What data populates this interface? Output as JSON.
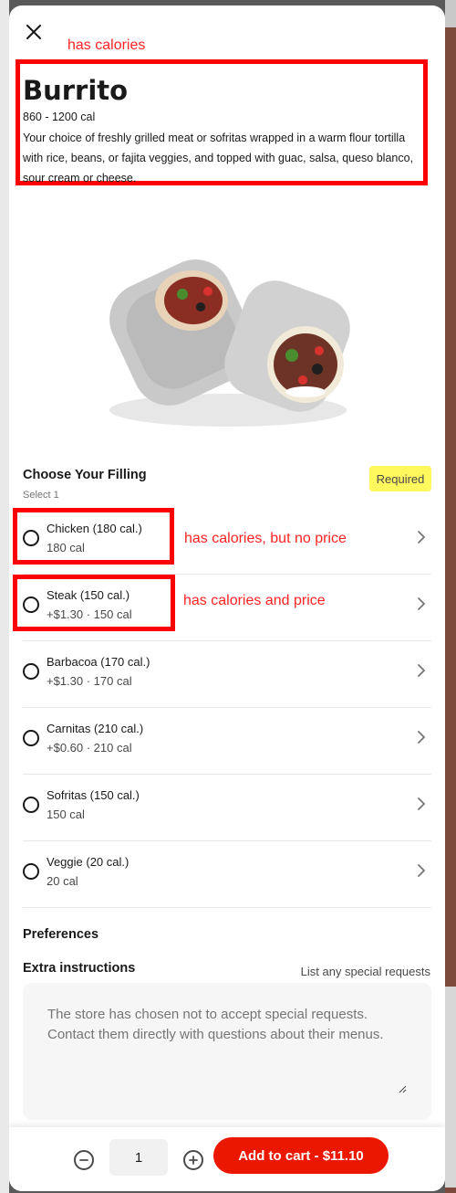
{
  "annotations": {
    "title_note": "has calories",
    "chicken_note": "has calories, but no price",
    "steak_note": "has calories and price"
  },
  "item": {
    "title": "Burrito",
    "calories": "860 - 1200 cal",
    "description": "Your choice of freshly grilled meat or sofritas wrapped in a warm flour tortilla with rice, beans, or fajita veggies, and topped with guac, salsa, queso blanco, sour cream or cheese."
  },
  "filling": {
    "title": "Choose Your Filling",
    "select_hint": "Select 1",
    "badge": "Required",
    "options": [
      {
        "name": "Chicken (180 cal.)",
        "sub": "180 cal"
      },
      {
        "name": "Steak (150 cal.)",
        "sub": "+$1.30 · 150 cal"
      },
      {
        "name": "Barbacoa (170 cal.)",
        "sub": "+$1.30 · 170 cal"
      },
      {
        "name": "Carnitas (210 cal.)",
        "sub": "+$0.60 · 210 cal"
      },
      {
        "name": "Sofritas (150 cal.)",
        "sub": "150 cal"
      },
      {
        "name": "Veggie (20 cal.)",
        "sub": "20 cal"
      }
    ]
  },
  "preferences": {
    "title": "Preferences",
    "instructions_label": "Extra instructions",
    "instructions_hint": "List any special requests",
    "instructions_placeholder": "The store has chosen not to accept special requests. Contact them directly with questions about their menus."
  },
  "footer": {
    "quantity": "1",
    "add_to_cart": "Add to cart - $11.10"
  },
  "colors": {
    "accent": "#eb1700",
    "annotation": "#ff0000",
    "required_badge": "#fff95e"
  },
  "icons": [
    "close-icon",
    "chevron-right-icon",
    "minus-icon",
    "plus-icon",
    "resize-grip-icon"
  ]
}
